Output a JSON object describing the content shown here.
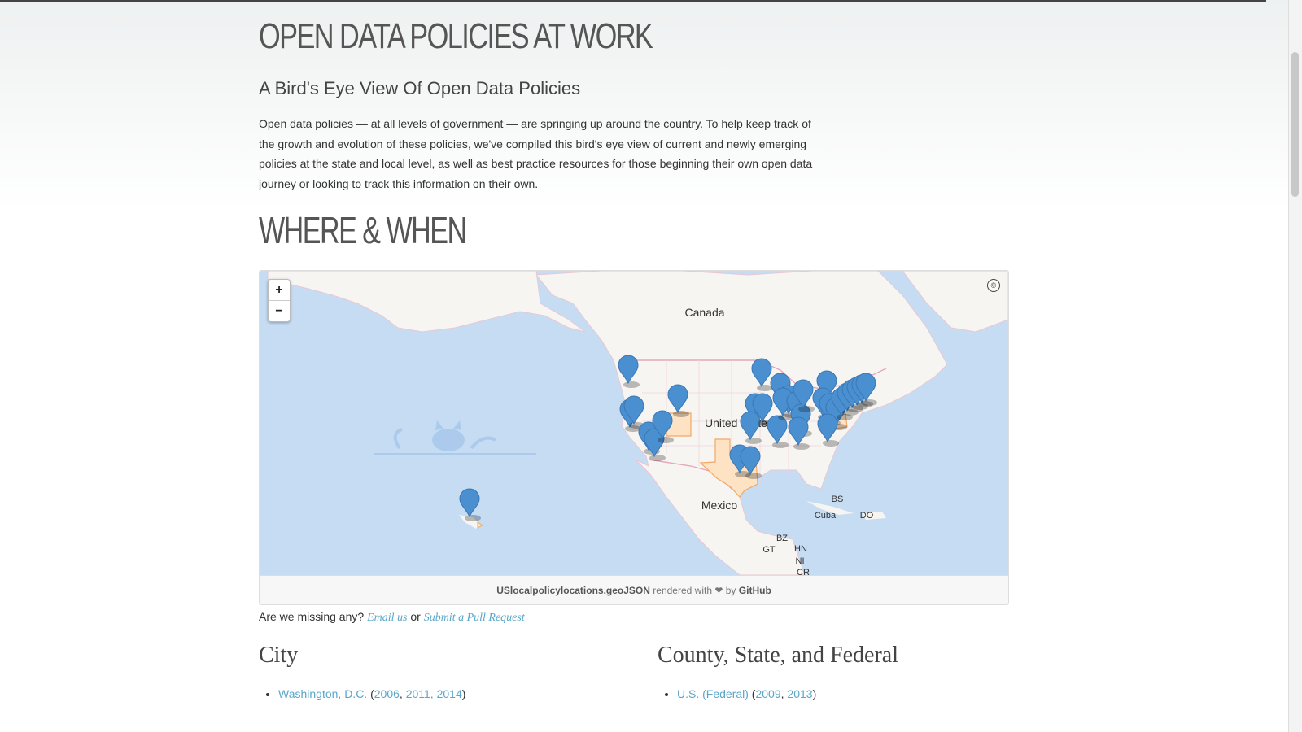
{
  "page": {
    "title": "OPEN DATA POLICIES AT WORK",
    "subtitle": "A Bird's Eye View Of Open Data Policies",
    "intro": "Open data policies — at all levels of government — are springing up around the country. To help keep track of the growth and evolution of these policies, we've compiled this bird's eye view of current and newly emerging policies at the state and local level, as well as best practice resources for those beginning their own open data journey or looking to track this information on their own.",
    "section_title": "WHERE & WHEN"
  },
  "map": {
    "zoom_in": "+",
    "zoom_out": "−",
    "attribution_icon": "©",
    "labels": {
      "canada": "Canada",
      "united_states": "United States",
      "mexico": "Mexico",
      "bs": "BS",
      "cuba": "Cuba",
      "do": "DO",
      "bz": "BZ",
      "gt": "GT",
      "hn": "HN",
      "ni": "NI",
      "cr": "CR"
    },
    "caption": {
      "file": "USlocalpolicylocations.geoJSON",
      "rendered": "rendered with",
      "heart": "❤",
      "by": "by",
      "host": "GitHub"
    },
    "colors": {
      "ocean": "#c5dcf3",
      "land": "#f6f5f1",
      "marker": "#4a90d0",
      "highlight": "#fde3c3"
    }
  },
  "missing": {
    "question": "Are we missing any?",
    "email_link": "Email us",
    "or": "or",
    "pr_link": "Submit a Pull Request"
  },
  "city": {
    "heading": "City",
    "items": [
      {
        "name": "Washington, D.C.",
        "years": [
          "2006",
          "2011, 2014"
        ]
      }
    ]
  },
  "county": {
    "heading": "County, State, and Federal",
    "items": [
      {
        "name": "U.S. (Federal)",
        "years": [
          "2009",
          "2013"
        ]
      }
    ]
  }
}
